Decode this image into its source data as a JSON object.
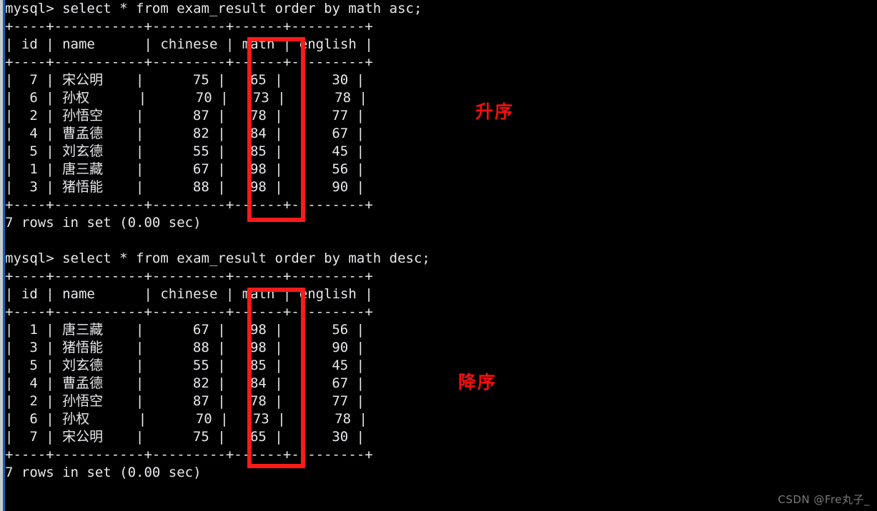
{
  "window": {
    "edge_gray": "#c8ccd0",
    "edge_blue": "#1464b4",
    "background": "#000000",
    "text_color": "#e8e8ec"
  },
  "terminal": {
    "prompt": "mysql> ",
    "lines": [
      "mysql> select * from exam_result order by math asc;",
      "+----+-----------+---------+------+---------+",
      "| id | name      | chinese | math | english |",
      "+----+-----------+---------+------+---------+",
      "|  7 | 宋公明    |      75 |   65 |      30 |",
      "|  6 | 孙权      |      70 |   73 |      78 |",
      "|  2 | 孙悟空    |      87 |   78 |      77 |",
      "|  4 | 曹孟德    |      82 |   84 |      67 |",
      "|  5 | 刘玄德    |      55 |   85 |      45 |",
      "|  1 | 唐三藏    |      67 |   98 |      56 |",
      "|  3 | 猪悟能    |      88 |   98 |      90 |",
      "+----+-----------+---------+------+---------+",
      "7 rows in set (0.00 sec)",
      "",
      "mysql> select * from exam_result order by math desc;",
      "+----+-----------+---------+------+---------+",
      "| id | name      | chinese | math | english |",
      "+----+-----------+---------+------+---------+",
      "|  1 | 唐三藏    |      67 |   98 |      56 |",
      "|  3 | 猪悟能    |      88 |   98 |      90 |",
      "|  5 | 刘玄德    |      55 |   85 |      45 |",
      "|  4 | 曹孟德    |      82 |   84 |      67 |",
      "|  2 | 孙悟空    |      87 |   78 |      77 |",
      "|  6 | 孙权      |      70 |   73 |      78 |",
      "|  7 | 宋公明    |      75 |   65 |      30 |",
      "+----+-----------+---------+------+---------+",
      "7 rows in set (0.00 sec)"
    ]
  },
  "queries": [
    {
      "sql": "select * from exam_result order by math asc;",
      "status": "7 rows in set (0.00 sec)",
      "row_count": 7,
      "duration": "0.00 sec",
      "columns": [
        "id",
        "name",
        "chinese",
        "math",
        "english"
      ],
      "rows": [
        [
          "7",
          "宋公明",
          "75",
          "65",
          "30"
        ],
        [
          "6",
          "孙权",
          "70",
          "73",
          "78"
        ],
        [
          "2",
          "孙悟空",
          "87",
          "78",
          "77"
        ],
        [
          "4",
          "曹孟德",
          "82",
          "84",
          "67"
        ],
        [
          "5",
          "刘玄德",
          "55",
          "85",
          "45"
        ],
        [
          "1",
          "唐三藏",
          "67",
          "98",
          "56"
        ],
        [
          "3",
          "猪悟能",
          "88",
          "98",
          "90"
        ]
      ]
    },
    {
      "sql": "select * from exam_result order by math desc;",
      "status": "7 rows in set (0.00 sec)",
      "row_count": 7,
      "duration": "0.00 sec",
      "columns": [
        "id",
        "name",
        "chinese",
        "math",
        "english"
      ],
      "rows": [
        [
          "1",
          "唐三藏",
          "67",
          "98",
          "56"
        ],
        [
          "3",
          "猪悟能",
          "88",
          "98",
          "90"
        ],
        [
          "5",
          "刘玄德",
          "55",
          "85",
          "45"
        ],
        [
          "4",
          "曹孟德",
          "82",
          "84",
          "67"
        ],
        [
          "2",
          "孙悟空",
          "87",
          "78",
          "77"
        ],
        [
          "6",
          "孙权",
          "70",
          "73",
          "78"
        ],
        [
          "7",
          "宋公明",
          "75",
          "65",
          "30"
        ]
      ]
    }
  ],
  "annotations": {
    "color": "#f01010",
    "ascending_label": "升序",
    "descending_label": "降序",
    "highlight_column": "math",
    "highlight_color": "#ff1a1a"
  },
  "watermark": {
    "text": "CSDN @Fre丸子_",
    "color": "#7a7a7a"
  }
}
